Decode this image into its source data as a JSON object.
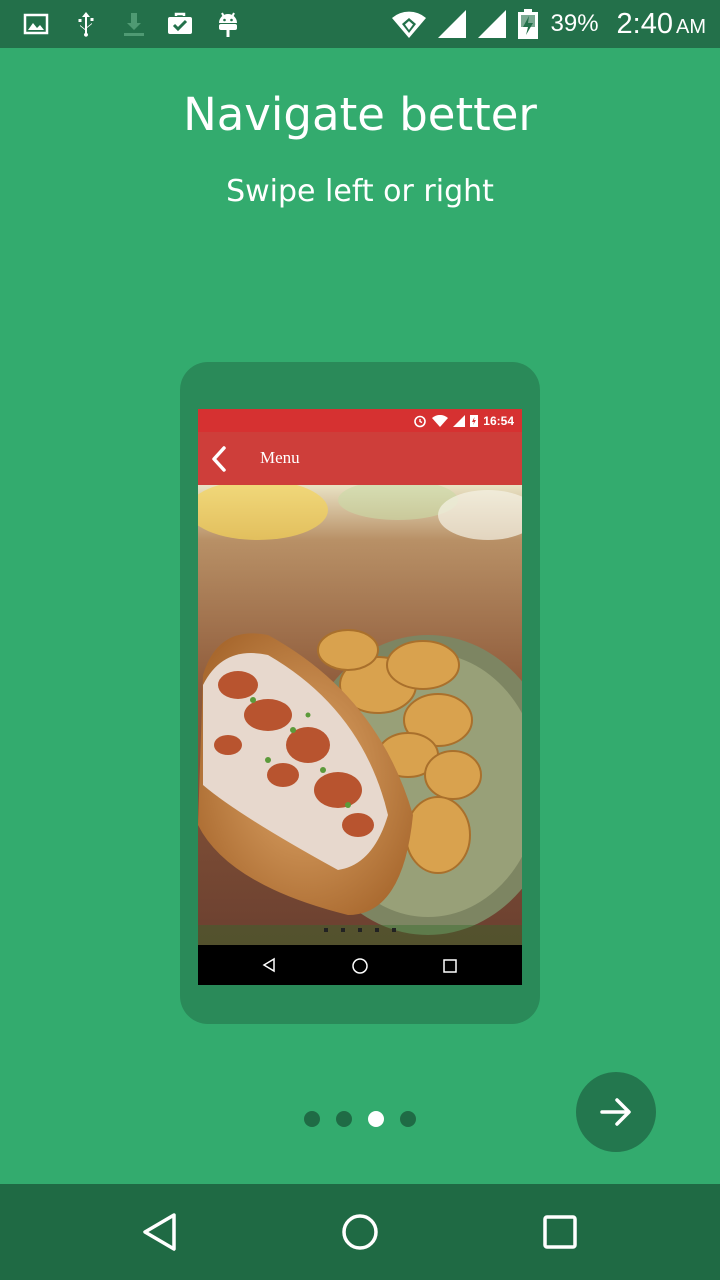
{
  "status_bar": {
    "left_icons": [
      "image-icon",
      "usb-icon",
      "download-icon",
      "briefcase-check-icon",
      "android-icon"
    ],
    "battery_percent": "39%",
    "time": "2:40",
    "ampm": "AM"
  },
  "onboarding": {
    "title": "Navigate better",
    "subtitle": "Swipe left or right",
    "page_count": 4,
    "current_page": 3
  },
  "mockup": {
    "status_time": "16:54",
    "app_title": "Menu",
    "carousel_dots": 5,
    "image": "lobster-roll-with-chips"
  },
  "buttons": {
    "next_icon": "arrow-right-icon"
  },
  "colors": {
    "background": "#33ab6e",
    "status_bar": "#23704a",
    "nav_bar": "#1f6a44",
    "mockup_accent": "#ce3e3a",
    "dot_active": "#ffffff",
    "dot_inactive": "#1f6b45"
  }
}
